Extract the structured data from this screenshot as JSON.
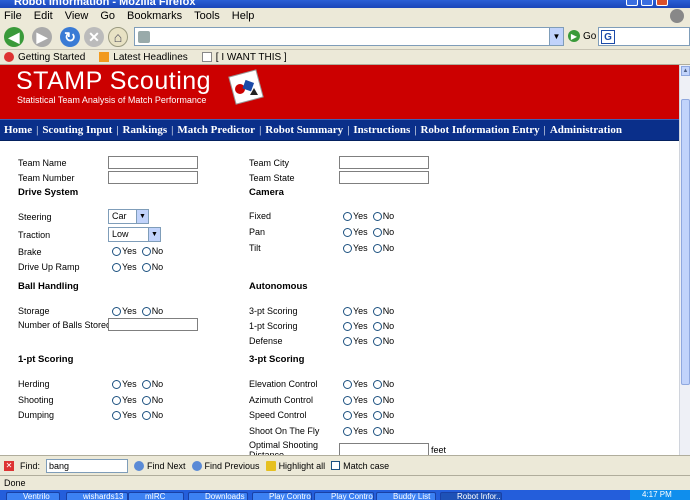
{
  "window": {
    "title": "Robot Information - Mozilla Firefox"
  },
  "menu": [
    "File",
    "Edit",
    "View",
    "Go",
    "Bookmarks",
    "Tools",
    "Help"
  ],
  "toolbar": {
    "go_label": "Go",
    "search_placeholder": ""
  },
  "bookmarks": [
    "Getting Started",
    "Latest Headlines",
    "[ I WANT THIS ]"
  ],
  "banner": {
    "title": "STAMP Scouting",
    "subtitle": "Statistical Team Analysis of Match Performance"
  },
  "nav": [
    "Home",
    "Scouting Input",
    "Rankings",
    "Match Predictor",
    "Robot Summary",
    "Instructions",
    "Robot Information Entry",
    "Administration"
  ],
  "form": {
    "team_name": "Team Name",
    "team_number": "Team Number",
    "team_city": "Team City",
    "team_state": "Team State",
    "drive_system": "Drive System",
    "camera": "Camera",
    "steering": "Steering",
    "steering_value": "Car",
    "traction": "Traction",
    "traction_value": "Low",
    "brake": "Brake",
    "drive_up_ramp": "Drive Up Ramp",
    "fixed": "Fixed",
    "pan": "Pan",
    "tilt": "Tilt",
    "ball_handling": "Ball Handling",
    "autonomous": "Autonomous",
    "storage": "Storage",
    "number_balls_stored": "Number of Balls Stored",
    "auto_3pt": "3-pt Scoring",
    "auto_1pt": "1-pt Scoring",
    "defense": "Defense",
    "one_pt_scoring": "1-pt Scoring",
    "three_pt_scoring": "3-pt Scoring",
    "herding": "Herding",
    "shooting": "Shooting",
    "dumping": "Dumping",
    "elevation_control": "Elevation Control",
    "azimuth_control": "Azimuth Control",
    "speed_control": "Speed Control",
    "shoot_on_the_fly": "Shoot On The Fly",
    "optimal_shooting_distance": "Optimal Shooting Distance",
    "feet": "feet",
    "yes": "Yes",
    "no": "No"
  },
  "findbar": {
    "label": "Find:",
    "value": "bang",
    "next": "Find Next",
    "previous": "Find Previous",
    "highlight": "Highlight all",
    "match_case": "Match case"
  },
  "status": "Done",
  "taskbar": [
    "Ventrilo",
    "wishards13",
    "mIRC",
    "Downloads",
    "Play Control",
    "Play Control",
    "Buddy List",
    "Robot Infor..."
  ],
  "clock": "4:17 PM"
}
